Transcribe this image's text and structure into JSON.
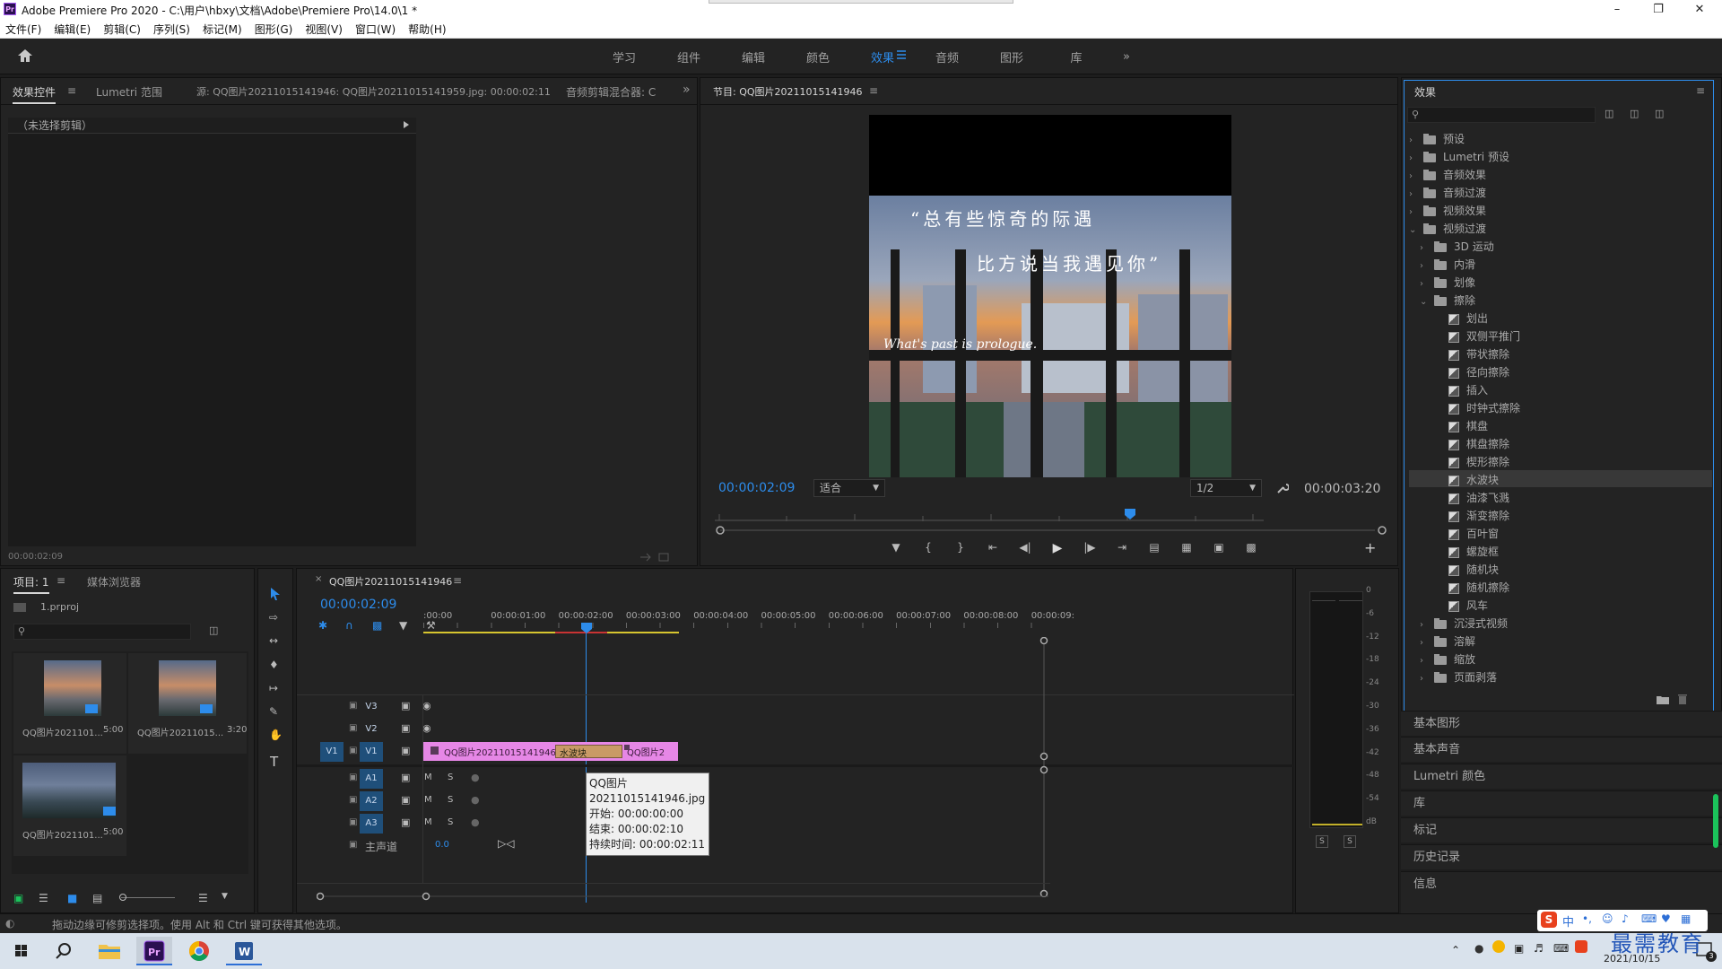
{
  "titlebar": {
    "logo": "Pr",
    "title": "Adobe Premiere Pro 2020 - C:\\用户\\hbxy\\文档\\Adobe\\Premiere Pro\\14.0\\1 *"
  },
  "menu": [
    "文件(F)",
    "编辑(E)",
    "剪辑(C)",
    "序列(S)",
    "标记(M)",
    "图形(G)",
    "视图(V)",
    "窗口(W)",
    "帮助(H)"
  ],
  "workspaces": {
    "tabs": [
      "学习",
      "组件",
      "编辑",
      "颜色",
      "效果",
      "音频",
      "图形",
      "库"
    ],
    "active": "效果",
    "overflow": "»"
  },
  "effect_controls": {
    "tabs": [
      "效果控件",
      "Lumetri 范围",
      "源: QQ图片20211015141946: QQ图片20211015141959.jpg: 00:00:02:11",
      "音频剪辑混合器: C"
    ],
    "no_clip": "（未选择剪辑）",
    "timecode": "00:00:02:09"
  },
  "program": {
    "title": "节目: QQ图片20211015141946",
    "current_time": "00:00:02:09",
    "fit": "适合",
    "resolution": "1/2",
    "duration": "00:00:03:20",
    "overlay_line1": "“总有些惊奇的际遇",
    "overlay_line2": "比方说当我遇见你”",
    "overlay_script": "What's past is prologue."
  },
  "effects": {
    "title": "效果",
    "search_placeholder": "",
    "tree": [
      {
        "label": "预设",
        "level": 0,
        "kind": "folder",
        "open": false
      },
      {
        "label": "Lumetri 预设",
        "level": 0,
        "kind": "folder",
        "open": false
      },
      {
        "label": "音频效果",
        "level": 0,
        "kind": "folder",
        "open": false
      },
      {
        "label": "音频过渡",
        "level": 0,
        "kind": "folder",
        "open": false
      },
      {
        "label": "视频效果",
        "level": 0,
        "kind": "folder",
        "open": false
      },
      {
        "label": "视频过渡",
        "level": 0,
        "kind": "folder",
        "open": true
      },
      {
        "label": "3D 运动",
        "level": 1,
        "kind": "folder",
        "open": false
      },
      {
        "label": "内滑",
        "level": 1,
        "kind": "folder",
        "open": false
      },
      {
        "label": "划像",
        "level": 1,
        "kind": "folder",
        "open": false
      },
      {
        "label": "擦除",
        "level": 1,
        "kind": "folder",
        "open": true
      },
      {
        "label": "划出",
        "level": 2,
        "kind": "effect"
      },
      {
        "label": "双侧平推门",
        "level": 2,
        "kind": "effect"
      },
      {
        "label": "带状擦除",
        "level": 2,
        "kind": "effect"
      },
      {
        "label": "径向擦除",
        "level": 2,
        "kind": "effect"
      },
      {
        "label": "插入",
        "level": 2,
        "kind": "effect"
      },
      {
        "label": "时钟式擦除",
        "level": 2,
        "kind": "effect"
      },
      {
        "label": "棋盘",
        "level": 2,
        "kind": "effect"
      },
      {
        "label": "棋盘擦除",
        "level": 2,
        "kind": "effect"
      },
      {
        "label": "楔形擦除",
        "level": 2,
        "kind": "effect"
      },
      {
        "label": "水波块",
        "level": 2,
        "kind": "effect",
        "selected": true
      },
      {
        "label": "油漆飞溅",
        "level": 2,
        "kind": "effect"
      },
      {
        "label": "渐变擦除",
        "level": 2,
        "kind": "effect"
      },
      {
        "label": "百叶窗",
        "level": 2,
        "kind": "effect"
      },
      {
        "label": "螺旋框",
        "level": 2,
        "kind": "effect"
      },
      {
        "label": "随机块",
        "level": 2,
        "kind": "effect"
      },
      {
        "label": "随机擦除",
        "level": 2,
        "kind": "effect"
      },
      {
        "label": "风车",
        "level": 2,
        "kind": "effect"
      },
      {
        "label": "沉浸式视频",
        "level": 1,
        "kind": "folder",
        "open": false
      },
      {
        "label": "溶解",
        "level": 1,
        "kind": "folder",
        "open": false
      },
      {
        "label": "缩放",
        "level": 1,
        "kind": "folder",
        "open": false
      },
      {
        "label": "页面剥落",
        "level": 1,
        "kind": "folder",
        "open": false
      }
    ]
  },
  "side_panels": [
    "基本图形",
    "基本声音",
    "Lumetri 颜色",
    "库",
    "标记",
    "历史记录",
    "信息"
  ],
  "project": {
    "tabs": [
      "项目: 1",
      "媒体浏览器"
    ],
    "file": "1.prproj",
    "items": [
      {
        "name": "QQ图片2021101...",
        "duration": "5:00"
      },
      {
        "name": "QQ图片20211015...",
        "duration": "3:20"
      },
      {
        "name": "QQ图片2021101...",
        "duration": "5:00"
      }
    ]
  },
  "timeline": {
    "title": "QQ图片20211015141946",
    "current_time": "00:00:02:09",
    "ruler": [
      ":00:00",
      "00:00:01:00",
      "00:00:02:00",
      "00:00:03:00",
      "00:00:04:00",
      "00:00:05:00",
      "00:00:06:00",
      "00:00:07:00",
      "00:00:08:00",
      "00:00:09:"
    ],
    "video_tracks": [
      "V3",
      "V2",
      "V1"
    ],
    "audio_tracks": [
      "A1",
      "A2",
      "A3"
    ],
    "source_v1": "V1",
    "mix_label": "主声道",
    "mix_value": "0.0",
    "track_m": "M",
    "track_s": "S",
    "clip1": "QQ图片20211015141946.jpg",
    "transition": "水波块",
    "clip2": "QQ图片2",
    "tooltip": {
      "name": "QQ图片20211015141946.jpg",
      "start": "开始: 00:00:00:00",
      "end": "结束: 00:00:02:10",
      "duration": "持续时间: 00:00:02:11"
    }
  },
  "meter": {
    "scale": [
      "0",
      "-6",
      "-12",
      "-18",
      "-24",
      "-30",
      "-36",
      "-42",
      "-48",
      "-54",
      "dB"
    ],
    "solo_left": "S",
    "solo_right": "S"
  },
  "status": {
    "text": "拖动边缘可修剪选择项。使用 Alt 和 Ctrl 键可获得其他选项。"
  },
  "taskbar": {
    "date": "2021/10/15",
    "ime": "中",
    "watermark": "最需教育",
    "notif_count": "3"
  },
  "colors": {
    "accent": "#2d8ceb",
    "clip": "#e687e6",
    "transition": "#c99a66",
    "selection": "#383838"
  }
}
